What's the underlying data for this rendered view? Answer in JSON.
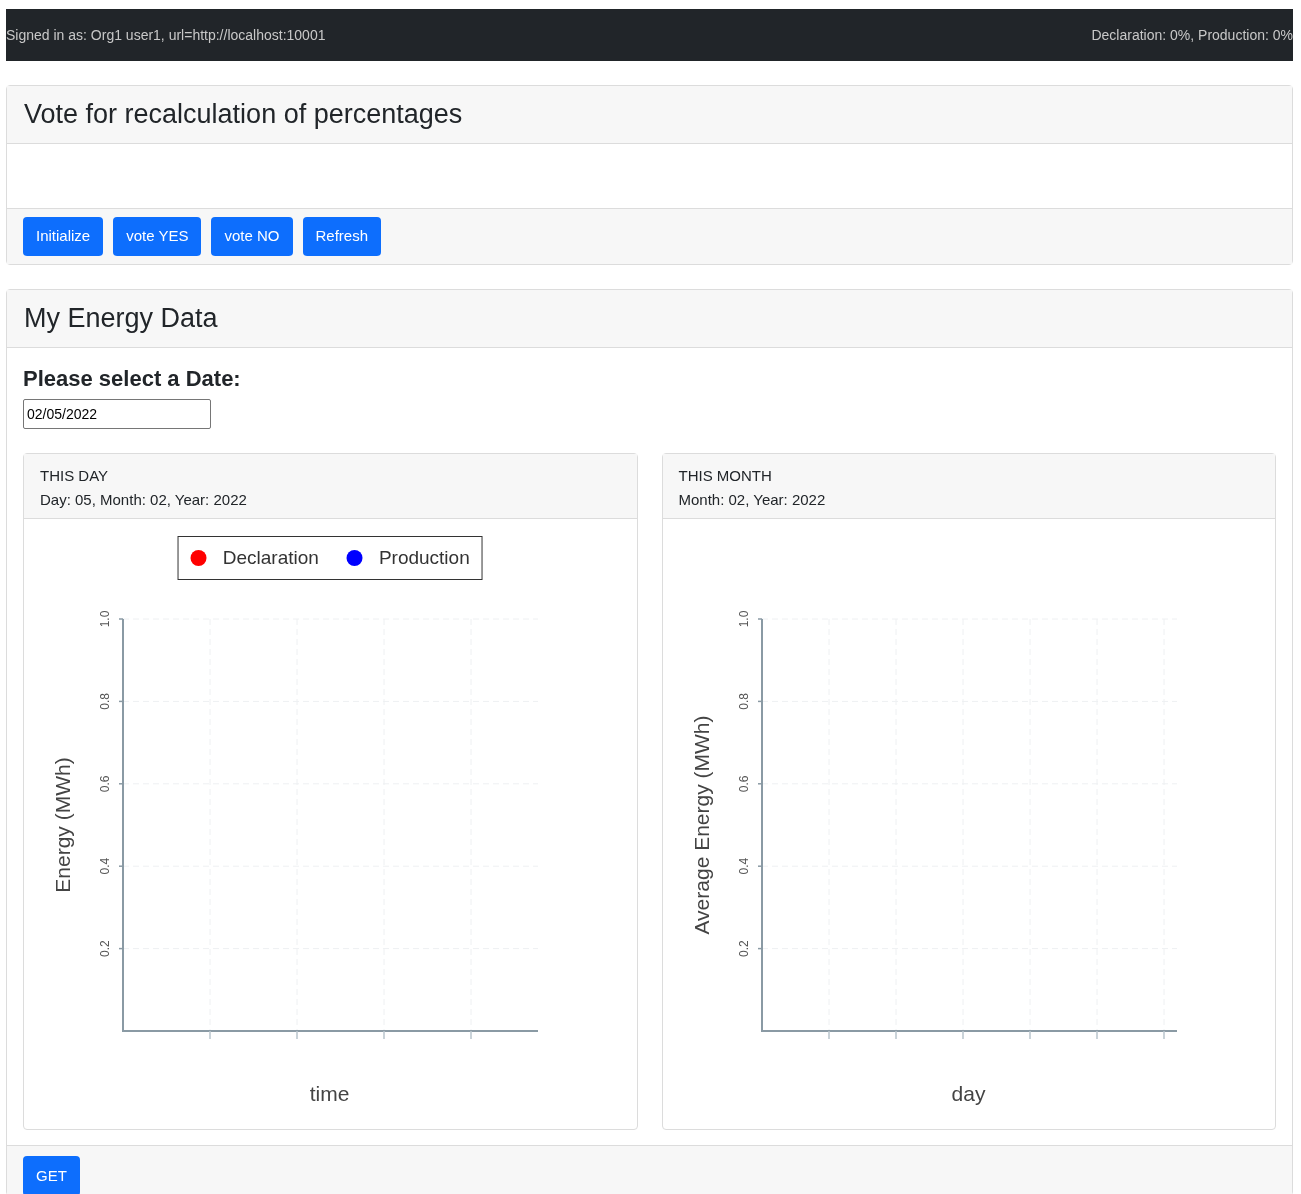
{
  "top_bar": {
    "signed_in": "Signed in as: Org1 user1, url=http://localhost:10001",
    "status": "Declaration: 0%, Production: 0%"
  },
  "vote_card": {
    "title": "Vote for recalculation of percentages",
    "buttons": [
      "Initialize",
      "vote YES",
      "vote NO",
      "Refresh"
    ]
  },
  "energy_card": {
    "title": "My Energy Data",
    "date_label": "Please select a Date:",
    "date_value": "02/05/2022",
    "panels": [
      {
        "title": "THIS DAY",
        "subtitle": "Day: 05, Month: 02, Year: 2022",
        "chart_data": {
          "type": "line",
          "xlabel": "time",
          "ylabel": "Energy (MWh)",
          "categories": [
            null,
            null,
            null,
            null
          ],
          "grid": true,
          "ylim": [
            0,
            1
          ],
          "yticks": [
            {
              "value": 0.2,
              "label": "0.2"
            },
            {
              "value": 0.4,
              "label": "0.4"
            },
            {
              "value": 0.6,
              "label": "0.6"
            },
            {
              "value": 0.8,
              "label": "0.8"
            },
            {
              "value": 1,
              "label": "1.0"
            }
          ],
          "series": [
            {
              "name": "Declaration",
              "color": "#ff0000",
              "values": [
                null,
                null,
                null,
                null
              ]
            },
            {
              "name": "Production",
              "color": "#0000ff",
              "values": [
                null,
                null,
                null,
                null
              ]
            }
          ]
        }
      },
      {
        "title": "THIS MONTH",
        "subtitle": "Month: 02, Year: 2022",
        "chart_data": {
          "type": "line",
          "xlabel": "day",
          "ylabel": "Average Energy (MWh)",
          "categories": [
            null,
            null,
            null,
            null,
            null,
            null
          ],
          "grid": true,
          "ylim": [
            0,
            1
          ],
          "yticks": [
            {
              "value": 0.2,
              "label": "0.2"
            },
            {
              "value": 0.4,
              "label": "0.4"
            },
            {
              "value": 0.6,
              "label": "0.6"
            },
            {
              "value": 0.8,
              "label": "0.8"
            },
            {
              "value": 1,
              "label": "1.0"
            }
          ]
        }
      }
    ],
    "footer_button": "GET"
  }
}
